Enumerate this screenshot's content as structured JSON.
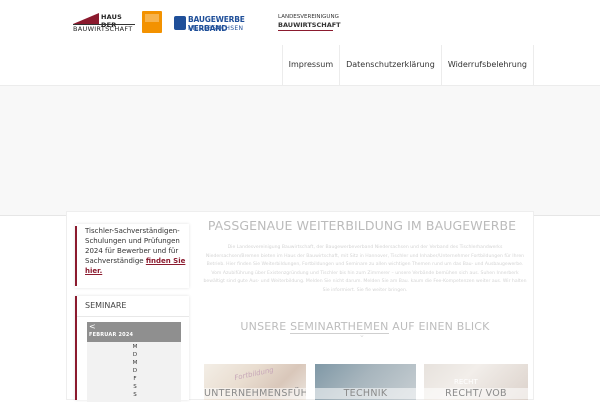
{
  "header": {
    "logos": [
      {
        "name": "hausderbauwirtschaft",
        "line1": "HAUS DER",
        "line2": "BAUWIRTSCHAFT"
      },
      {
        "name": "orange-square-logo"
      },
      {
        "name": "baugewerbeverband",
        "line1": "BAUGEWERBE VERBAND",
        "line2": "NIEDERSACHSEN"
      },
      {
        "name": "landesvereinigung",
        "line1": "LANDESVEREINIGUNG",
        "line2": "BAUWIRTSCHAFT"
      }
    ],
    "nav": [
      "Impressum",
      "Datenschutzerklärung",
      "Widerrufsbelehrung"
    ]
  },
  "sidebar": {
    "notice_text": "Tischler-Sachverständigen-Schulungen und Prüfungen 2024 für Bewerber und für Sachverständige ",
    "notice_link": "finden Sie hier.",
    "seminare_heading": "SEMINARE",
    "calendar": {
      "prev": "<",
      "month": "FEBRUAR 2024",
      "day_letters": [
        "M",
        "D",
        "M",
        "D",
        "F",
        "S",
        "S"
      ]
    }
  },
  "main": {
    "title": "PASSGENAUE WEITERBILDUNG IM BAUGEWERBE",
    "paragraph": "Die Landesvereinigung Bauwirtschaft, der Baugewerbeverband Niedersachsen und der Verband des Tischlerhandwerks Niedersachsen/Bremen bieten im Haus der Bauwirtschaft, mit Sitz in Hannover, Tischler und Inhaber/Unternehmer Fortbildungen für Ihren Betrieb. Hier finden Sie Weiterbildungen, Fortbildungen und Seminare zu allen wichtigen Themen rund um das Bau- und Ausbaugewerbe. Vom Azubiführung über Existenzgründung und Tischler bis hin zum Zimmerer – unsere Verbände bemühen sich aus. Suhen Innerberk bewältigt sind gute Aus- und Weiterbildung. Melden Sie nicht darum. Melden Sie am Bau. kaum die Fee-Kompetenzen weiter aus. Wir halten Sie informiert. Sie fie weiter bringen.",
    "subtitle_pre": "UNSERE ",
    "subtitle_u": "SEMINARTHEMEN",
    "subtitle_post": " AUF EINEN BLICK",
    "cards": [
      {
        "label": "UNTERNEHMENSFÜHRUNG",
        "deco": "Fortbildung"
      },
      {
        "label": "TECHNIK",
        "deco": ""
      },
      {
        "label": "RECHT/ VOB",
        "deco": "RECHT"
      }
    ]
  }
}
